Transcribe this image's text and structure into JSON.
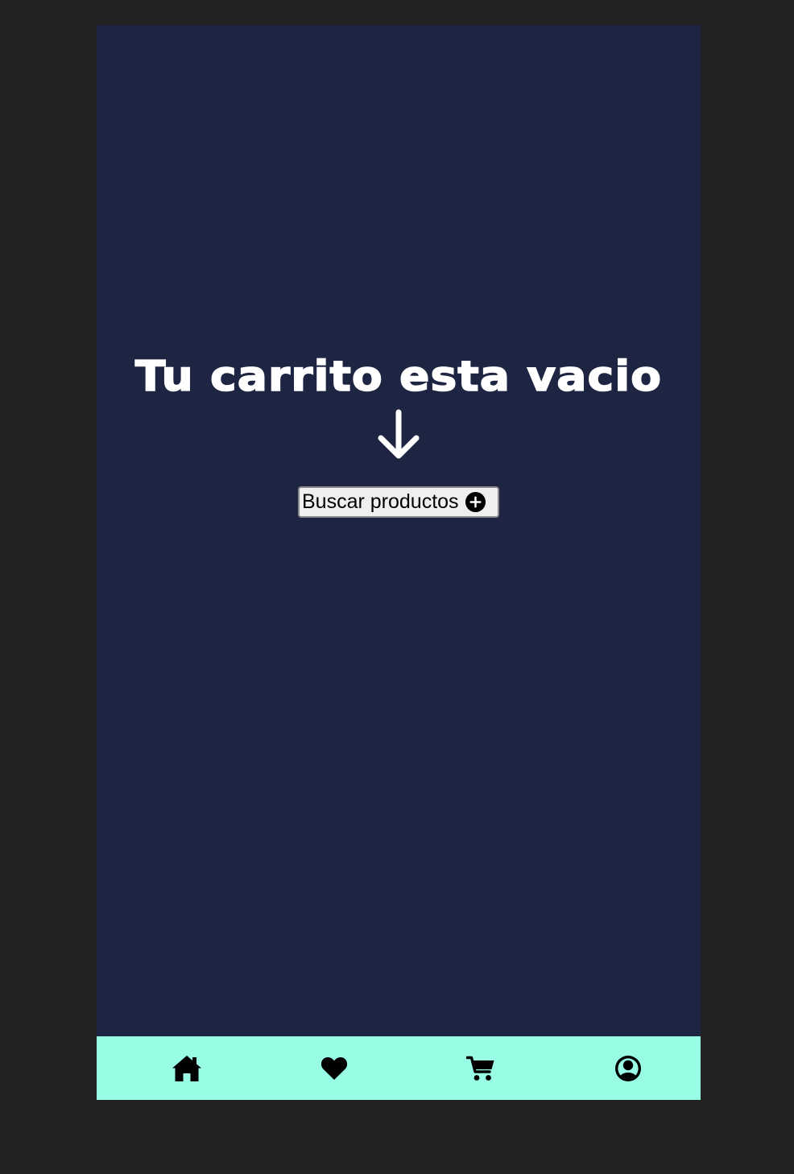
{
  "main": {
    "empty_title": "Tu carrito esta vacio",
    "arrow_icon": "arrow-down-icon",
    "search_button": {
      "label": "Buscar productos",
      "icon": "plus-circle-icon"
    }
  },
  "bottom_nav": {
    "items": [
      {
        "icon": "home-icon"
      },
      {
        "icon": "heart-icon"
      },
      {
        "icon": "cart-icon"
      },
      {
        "icon": "user-circle-icon"
      }
    ]
  },
  "colors": {
    "page_background": "#222222",
    "screen_background": "#1e2542",
    "nav_background": "#98fde4",
    "title_text": "#ffffff",
    "icon_color": "#000000"
  }
}
